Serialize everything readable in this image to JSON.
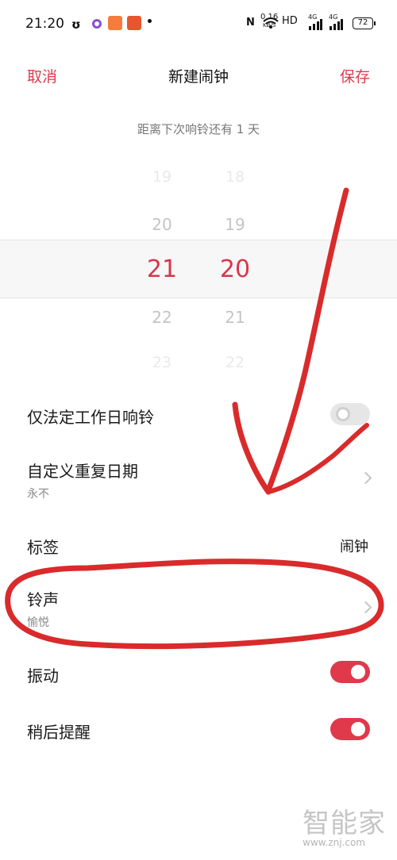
{
  "status_bar": {
    "time": "21:20",
    "net_speed_value": "0.16",
    "net_speed_unit": "KB/S",
    "hd_label": "HD",
    "signal_1_label": "4G",
    "signal_2_label": "4G",
    "battery": "72"
  },
  "header": {
    "cancel_label": "取消",
    "title": "新建闹钟",
    "save_label": "保存"
  },
  "countdown_text": "距离下次响铃还有  1 天",
  "time_picker": {
    "hours": [
      "19",
      "20",
      "21",
      "22",
      "23"
    ],
    "minutes": [
      "18",
      "19",
      "20",
      "21",
      "22"
    ],
    "selected_hour": "21",
    "selected_minute": "20"
  },
  "settings": {
    "workday_only": {
      "label": "仅法定工作日响铃",
      "enabled": false
    },
    "repeat": {
      "label": "自定义重复日期",
      "value": "永不"
    },
    "tag": {
      "label": "标签",
      "value": "闹钟"
    },
    "ringtone": {
      "label": "铃声",
      "value": "愉悦"
    },
    "vibrate": {
      "label": "振动",
      "enabled": true
    },
    "snooze": {
      "label": "稍后提醒",
      "enabled": true
    }
  },
  "watermark": {
    "text": "智能家",
    "url": "www.znj.com"
  },
  "colors": {
    "accent": "#e0394c",
    "annotation": "#d92b2b"
  }
}
